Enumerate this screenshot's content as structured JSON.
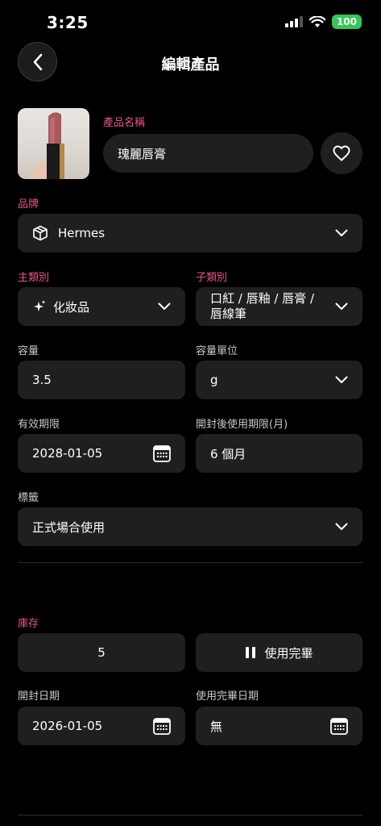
{
  "status": {
    "time": "3:25",
    "battery": "100"
  },
  "header": {
    "title": "編輯產品"
  },
  "product": {
    "name_label": "產品名稱",
    "name_value": "瑰麗唇膏"
  },
  "brand": {
    "label": "品牌",
    "value": "Hermes"
  },
  "category": {
    "main_label": "主類別",
    "main_value": "化妝品",
    "sub_label": "子類別",
    "sub_value_line1": "口紅 / 唇釉 / 唇膏 /",
    "sub_value_line2": "唇線筆"
  },
  "capacity": {
    "label": "容量",
    "value": "3.5",
    "unit_label": "容量單位",
    "unit_value": "g"
  },
  "expiry": {
    "label": "有效期限",
    "value": "2028-01-05",
    "after_open_label": "開封後使用期限(月)",
    "after_open_value": "6 個月"
  },
  "tags": {
    "label": "標籤",
    "value": "正式場合使用"
  },
  "inventory": {
    "label": "庫存",
    "value": "5",
    "used_up_button": "使用完畢"
  },
  "dates": {
    "opened_label": "開封日期",
    "opened_value": "2026-01-05",
    "finished_label": "使用完畢日期",
    "finished_value": "無"
  },
  "colors": {
    "accent": "#e8548f",
    "field_bg": "#1f1f21",
    "battery": "#34c759"
  }
}
